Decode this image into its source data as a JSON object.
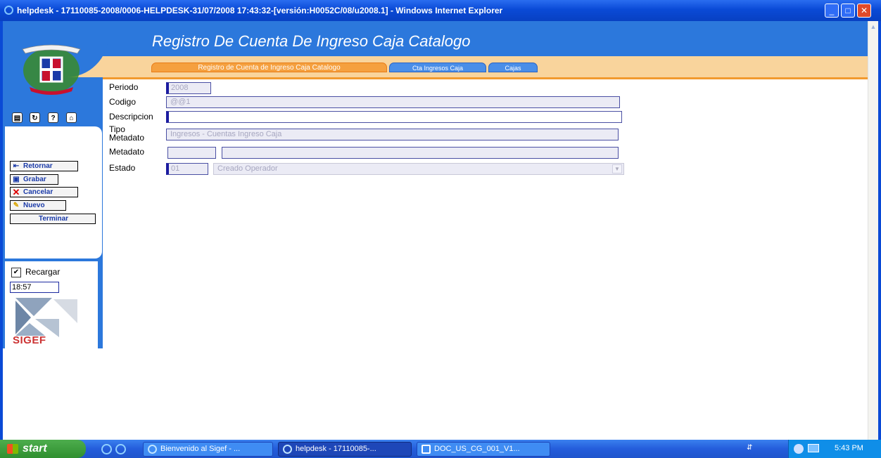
{
  "window": {
    "title": "helpdesk - 17110085-2008/0006-HELPDESK-31/07/2008 17:43:32-[versión:H0052C/08/u2008.1] - Windows Internet Explorer",
    "minimize": "_",
    "maximize": "□",
    "close": "✕"
  },
  "page": {
    "title": "Registro De Cuenta De Ingreso Caja Catalogo"
  },
  "tabs": [
    {
      "label": "Registro de Cuenta de Ingreso Caja Catalogo"
    },
    {
      "label": "Cta Ingresos Caja"
    },
    {
      "label": "Cajas"
    }
  ],
  "sidebar": {
    "buttons": {
      "retornar": "Retornar",
      "grabar": "Grabar",
      "cancelar": "Cancelar",
      "nuevo": "Nuevo",
      "terminar": "Terminar"
    },
    "recargar_label": "Recargar",
    "recargar_checked": true,
    "time": "18:57",
    "logo_text": "SIGEF"
  },
  "form": {
    "periodo": {
      "label": "Periodo",
      "value": "2008"
    },
    "codigo": {
      "label": "Codigo",
      "value": "@@1"
    },
    "descripcion": {
      "label": "Descripcion",
      "value": ""
    },
    "tipo_metadato": {
      "label_line1": "Tipo",
      "label_line2": "Metadato",
      "value": "Ingresos - Cuentas Ingreso Caja"
    },
    "metadato": {
      "label": "Metadato",
      "code": "",
      "description": ""
    },
    "estado": {
      "label": "Estado",
      "code": "01",
      "value": "Creado Operador"
    }
  },
  "taskbar": {
    "start": "start",
    "tasks": [
      {
        "label": "Bienvenido al Sigef - ..."
      },
      {
        "label": "helpdesk - 17110085-..."
      },
      {
        "label": "DOC_US_CG_001_V1..."
      }
    ],
    "clock": "5:43 PM"
  },
  "colors": {
    "header_blue": "#2c78dc",
    "tab_orange": "#f5a03f",
    "tab_band": "#f9d49c",
    "xp_titlebar": "#0a4ad6"
  }
}
